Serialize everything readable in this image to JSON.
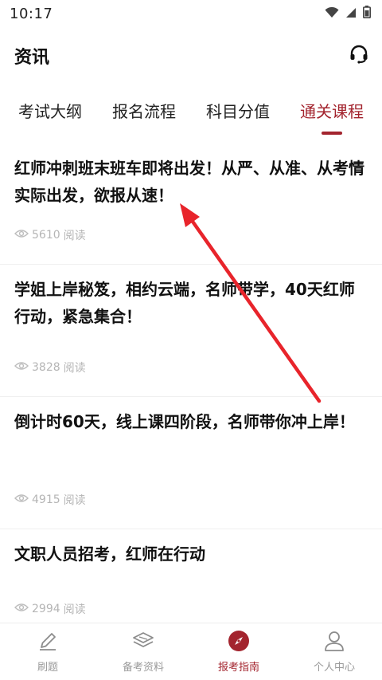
{
  "status_bar": {
    "time": "10:17"
  },
  "header": {
    "title": "资讯"
  },
  "tabs": [
    {
      "label": "考试大纲",
      "active": false
    },
    {
      "label": "报名流程",
      "active": false
    },
    {
      "label": "科目分值",
      "active": false
    },
    {
      "label": "通关课程",
      "active": true
    }
  ],
  "articles": [
    {
      "title": "红师冲刺班末班车即将出发！从严、从准、从考情实际出发，欲报从速！",
      "reads": "5610",
      "reads_label": "阅读"
    },
    {
      "title": "学姐上岸秘笈，相约云端，名师带学，40天红师行动，紧急集合！",
      "reads": "3828",
      "reads_label": "阅读"
    },
    {
      "title": "倒计时60天，线上课四阶段，名师带你冲上岸！",
      "reads": "4915",
      "reads_label": "阅读"
    },
    {
      "title": "文职人员招考，红师在行动",
      "reads": "2994",
      "reads_label": "阅读"
    }
  ],
  "bottom_nav": [
    {
      "label": "刷题",
      "icon": "pencil-icon",
      "active": false
    },
    {
      "label": "备考资料",
      "icon": "layers-icon",
      "active": false
    },
    {
      "label": "报考指南",
      "icon": "compass-icon",
      "active": true
    },
    {
      "label": "个人中心",
      "icon": "person-icon",
      "active": false
    }
  ],
  "colors": {
    "accent": "#a3242e",
    "muted": "#b5b5b5",
    "annotation": "#e8242b"
  }
}
